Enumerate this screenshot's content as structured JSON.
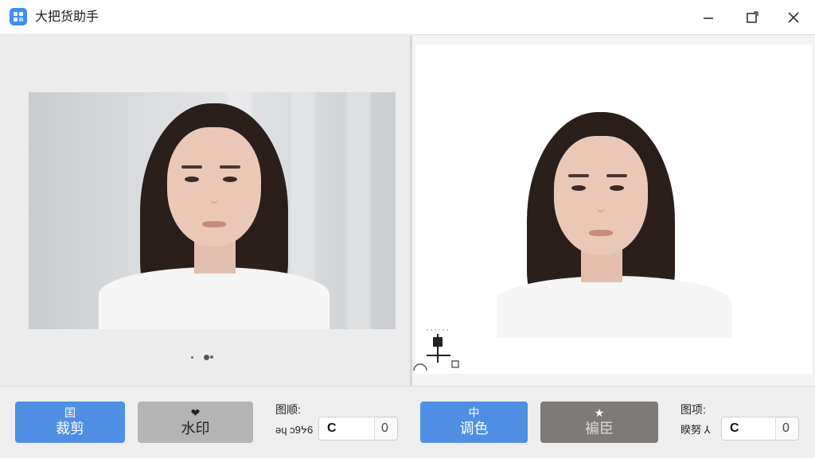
{
  "app": {
    "title": "大把货助手"
  },
  "window_controls": [
    "minimize",
    "maximize",
    "close"
  ],
  "left_controls": {
    "crop_button": {
      "icon": "囯",
      "label": "裁剪"
    },
    "watermark_button": {
      "icon": "❤",
      "label": "水印"
    },
    "field_label_top": "图顺:",
    "field_label_bottom": "ǝɥ ɔ9ᔭ6",
    "input_value": "C",
    "stepper_value": "0"
  },
  "right_controls": {
    "color_button": {
      "icon": "中",
      "label": "调色"
    },
    "disabled_button": {
      "icon": "★",
      "label": "褊臣"
    },
    "field_label_top": "图项:",
    "field_label_bottom": "睽努 ⅄",
    "input_value": "C",
    "stepper_value": "0"
  },
  "colors": {
    "accent": "#4f8fe3",
    "app_icon": "#3d8ff0",
    "panel_bg": "#ececec"
  }
}
